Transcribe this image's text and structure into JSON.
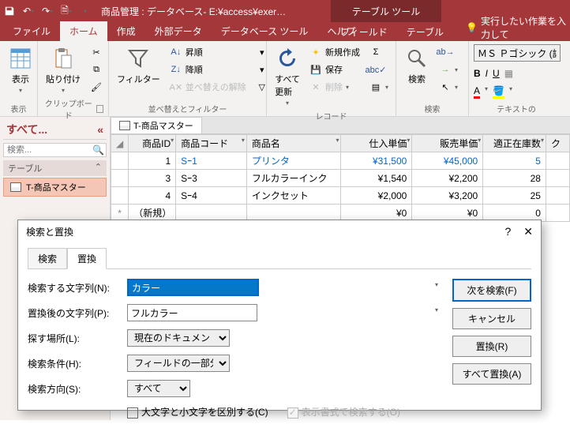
{
  "title_bar": {
    "app_title": "商品管理 : データベース- E:¥access¥exer…",
    "contextual_label": "テーブル ツール"
  },
  "tabs": {
    "file": "ファイル",
    "home": "ホーム",
    "create": "作成",
    "external": "外部データ",
    "db_tools": "データベース ツール",
    "help": "ヘルプ",
    "fields": "フィールド",
    "table": "テーブル",
    "tell_me": "実行したい作業を入力して"
  },
  "ribbon": {
    "view": "表示",
    "paste": "貼り付け",
    "clipboard_group": "クリップボード",
    "filter": "フィルター",
    "asc": "昇順",
    "desc": "降順",
    "remove_sort": "並べ替えの解除",
    "sort_filter_group": "並べ替えとフィルター",
    "refresh": "すべて\n更新",
    "new_rec": "新規作成",
    "save_rec": "保存",
    "delete_rec": "削除",
    "records_group": "レコード",
    "find": "検索",
    "find_group": "検索",
    "font_name": "ＭＳ Ｐゴシック (詳細",
    "text_group": "テキストの"
  },
  "nav": {
    "title": "すべて...",
    "search_placeholder": "検索...",
    "group_tables": "テーブル",
    "item_product": "T-商品マスター"
  },
  "doc_tab": "T-商品マスター",
  "grid": {
    "columns": [
      "商品ID",
      "商品コード",
      "商品名",
      "仕入単価",
      "販売単価",
      "適正在庫数",
      "ク"
    ],
    "rows": [
      {
        "id": "1",
        "code": "Sｰ1",
        "name": "プリンタ",
        "cost": "¥31,500",
        "price": "¥45,000",
        "stock": "5"
      },
      {
        "id": "3",
        "code": "Sｰ3",
        "name": "フルカラーインク",
        "cost": "¥1,540",
        "price": "¥2,200",
        "stock": "28"
      },
      {
        "id": "4",
        "code": "Sｰ4",
        "name": "インクセット",
        "cost": "¥2,000",
        "price": "¥3,200",
        "stock": "25"
      }
    ],
    "new_row": {
      "label": "（新規）",
      "zero": "¥0",
      "stock": "0"
    }
  },
  "dialog": {
    "title": "検索と置換",
    "tab_find": "検索",
    "tab_replace": "置換",
    "find_label": "検索する文字列(N):",
    "find_value": "カラー",
    "replace_label": "置換後の文字列(P):",
    "replace_value": "フルカラー",
    "look_in_label": "探す場所(L):",
    "look_in_value": "現在のドキュメント",
    "match_label": "検索条件(H):",
    "match_value": "フィールドの一部分",
    "direction_label": "検索方向(S):",
    "direction_value": "すべて",
    "case_check": "大文字と小文字を区別する(C)",
    "format_check": "表示書式で検索する(O)",
    "btn_find_next": "次を検索(F)",
    "btn_cancel": "キャンセル",
    "btn_replace": "置換(R)",
    "btn_replace_all": "すべて置換(A)"
  }
}
